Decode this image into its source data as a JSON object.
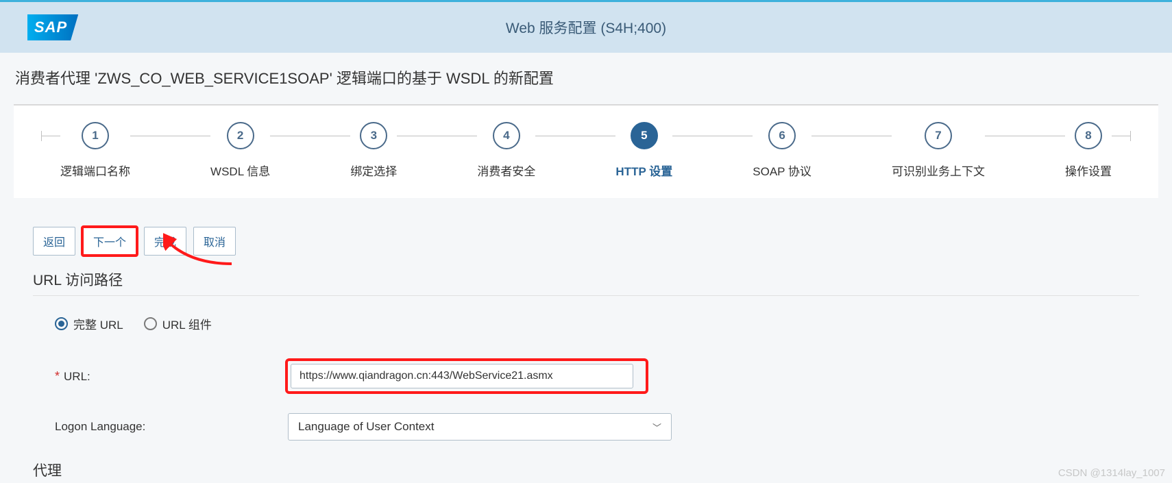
{
  "header": {
    "logo": "SAP",
    "title": "Web 服务配置 (S4H;400)"
  },
  "page": {
    "title": "消费者代理 'ZWS_CO_WEB_SERVICE1SOAP' 逻辑端口的基于 WSDL 的新配置"
  },
  "wizard": {
    "steps": [
      {
        "num": "1",
        "label": "逻辑端口名称"
      },
      {
        "num": "2",
        "label": "WSDL 信息"
      },
      {
        "num": "3",
        "label": "绑定选择"
      },
      {
        "num": "4",
        "label": "消费者安全"
      },
      {
        "num": "5",
        "label": "HTTP 设置"
      },
      {
        "num": "6",
        "label": "SOAP 协议"
      },
      {
        "num": "7",
        "label": "可识别业务上下文"
      },
      {
        "num": "8",
        "label": "操作设置"
      }
    ],
    "activeIndex": 4
  },
  "buttons": {
    "back": "返回",
    "next": "下一个",
    "finish": "完成",
    "cancel": "取消"
  },
  "sections": {
    "urlPath": "URL 访问路径",
    "proxy": "代理"
  },
  "radios": {
    "fullUrl": "完整 URL",
    "urlComponent": "URL 组件"
  },
  "fields": {
    "url": {
      "label": "URL:",
      "value": "https://www.qiandragon.cn:443/WebService21.asmx"
    },
    "logonLanguage": {
      "label": "Logon Language:",
      "value": "Language of User Context"
    }
  },
  "watermark": "CSDN @1314lay_1007"
}
